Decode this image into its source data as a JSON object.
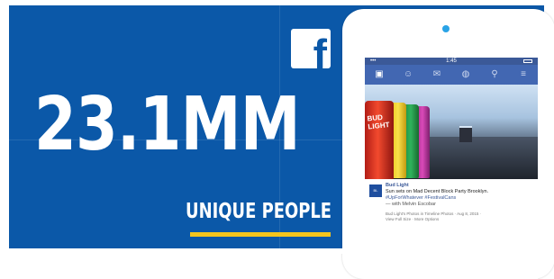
{
  "colors": {
    "brand_blue": "#0b58a8",
    "accent_yellow": "#f5c51c",
    "facebook_blue": "#3b5998"
  },
  "logo": {
    "glyph": "f",
    "icon": "facebook-icon"
  },
  "stat": {
    "value": "23.1MM",
    "label": "UNIQUE PEOPLE"
  },
  "phone": {
    "status_bar": {
      "time": "1:45"
    },
    "nav_icons": [
      "home-icon",
      "friends-icon",
      "messages-icon",
      "globe-icon",
      "search-icon",
      "menu-icon"
    ],
    "photo": {
      "can_text": "BUD LIGHT"
    },
    "post": {
      "author": "Bud Light",
      "text": "Sun sets on Mad Decent Block Party Brooklyn.",
      "hashtags": "#UpForWhatever #FestivalCans",
      "with": "— with Melvin Escobar",
      "meta": "Bud Light's Photos in Timeline Photos · Aug 8, 2015 · ",
      "actions": "View Full Size · More Options"
    }
  }
}
